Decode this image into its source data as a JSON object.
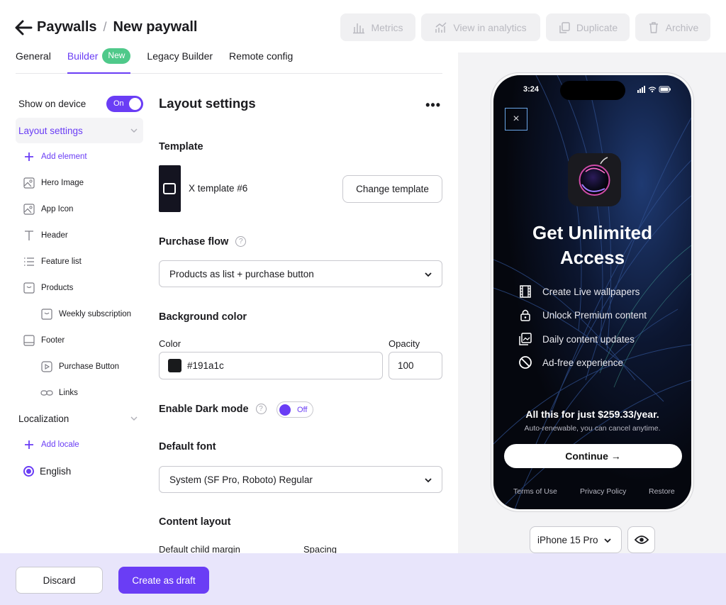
{
  "header": {
    "breadcrumb_parent": "Paywalls",
    "breadcrumb_separator": "/",
    "title": "New paywall",
    "actions": {
      "metrics": "Metrics",
      "view_in_analytics": "View in analytics",
      "duplicate": "Duplicate",
      "archive": "Archive"
    }
  },
  "tabs": {
    "general": "General",
    "builder": "Builder",
    "builder_badge": "New",
    "legacy_builder": "Legacy Builder",
    "remote_config": "Remote config",
    "active": "Builder"
  },
  "sidebar": {
    "show_on_device_label": "Show on device",
    "show_on_device_toggle": "On",
    "layout_settings": "Layout settings",
    "add_element": "Add element",
    "elements": {
      "hero_image": "Hero Image",
      "app_icon": "App Icon",
      "header": "Header",
      "feature_list": "Feature list",
      "products": "Products",
      "weekly_subscription": "Weekly subscription",
      "footer": "Footer",
      "purchase_button": "Purchase Button",
      "links": "Links"
    },
    "localization": "Localization",
    "add_locale": "Add locale",
    "locale_selected": "English"
  },
  "main": {
    "title": "Layout settings",
    "more": "•••",
    "template": {
      "heading": "Template",
      "name": "X template #6",
      "change_button": "Change template"
    },
    "purchase_flow": {
      "heading": "Purchase flow",
      "help": "?",
      "value": "Products as list + purchase button"
    },
    "background_color": {
      "heading": "Background color",
      "color_label": "Color",
      "color_value": "#191a1c",
      "opacity_label": "Opacity",
      "opacity_value": "100"
    },
    "dark_mode": {
      "label": "Enable Dark mode",
      "help": "?",
      "toggle": "Off"
    },
    "default_font": {
      "heading": "Default font",
      "value": "System (SF Pro, Roboto) Regular"
    },
    "content_layout": {
      "heading": "Content layout",
      "child_margin_label": "Default child margin",
      "spacing_label": "Spacing"
    }
  },
  "preview": {
    "time": "3:24",
    "close": "×",
    "headline_line1": "Get Unlimited",
    "headline_line2": "Access",
    "features": [
      {
        "icon": "film-icon",
        "text": "Create Live wallpapers"
      },
      {
        "icon": "lock-icon",
        "text": "Unlock Premium content"
      },
      {
        "icon": "gallery-icon",
        "text": "Daily content updates"
      },
      {
        "icon": "no-ads-icon",
        "text": "Ad-free experience"
      }
    ],
    "price": "All this for just $259.33/year.",
    "renewal": "Auto-renewable, you can cancel anytime.",
    "continue": "Continue →",
    "footer_links": {
      "terms": "Terms of Use",
      "privacy": "Privacy Policy",
      "restore": "Restore"
    },
    "device": "iPhone 15 Pro"
  },
  "footer_bar": {
    "discard": "Discard",
    "create_draft": "Create as draft"
  },
  "colors": {
    "accent": "#6a3df5",
    "badge_green": "#4fc98a",
    "bottom_bar": "#e8e5fb",
    "preview_bg": "#f3f3f5"
  }
}
